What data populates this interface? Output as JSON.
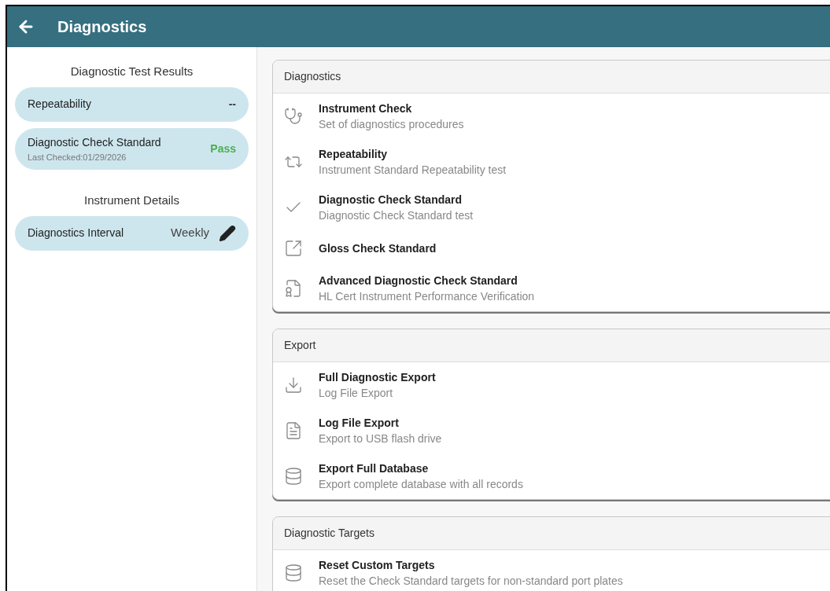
{
  "header": {
    "title": "Diagnostics"
  },
  "sidebar": {
    "results_title": "Diagnostic Test Results",
    "results": [
      {
        "label": "Repeatability",
        "value": "--",
        "color": "#333333"
      },
      {
        "label": "Diagnostic Check Standard",
        "sublabel": "Last Checked:01/29/2026",
        "value": "Pass",
        "color": "#4caf50"
      }
    ],
    "details_title": "Instrument Details",
    "details": [
      {
        "label": "Diagnostics Interval",
        "value": "Weekly"
      }
    ]
  },
  "sections": [
    {
      "title": "Diagnostics",
      "items": [
        {
          "title": "Instrument Check",
          "subtitle": "Set of diagnostics procedures"
        },
        {
          "title": "Repeatability",
          "subtitle": "Instrument Standard Repeatability test"
        },
        {
          "title": "Diagnostic Check Standard",
          "subtitle": "Diagnostic Check Standard test"
        },
        {
          "title": "Gloss Check Standard"
        },
        {
          "title": "Advanced Diagnostic Check Standard",
          "subtitle": "HL Cert Instrument Performance Verification"
        }
      ]
    },
    {
      "title": "Export",
      "items": [
        {
          "title": "Full Diagnostic Export",
          "subtitle": "Log File Export"
        },
        {
          "title": "Log File Export",
          "subtitle": "Export to USB flash drive"
        },
        {
          "title": "Export Full Database",
          "subtitle": "Export complete database with all records"
        }
      ]
    },
    {
      "title": "Diagnostic Targets",
      "items": [
        {
          "title": "Reset Custom Targets",
          "subtitle": "Reset the Check Standard targets for non-standard port plates"
        }
      ]
    }
  ]
}
